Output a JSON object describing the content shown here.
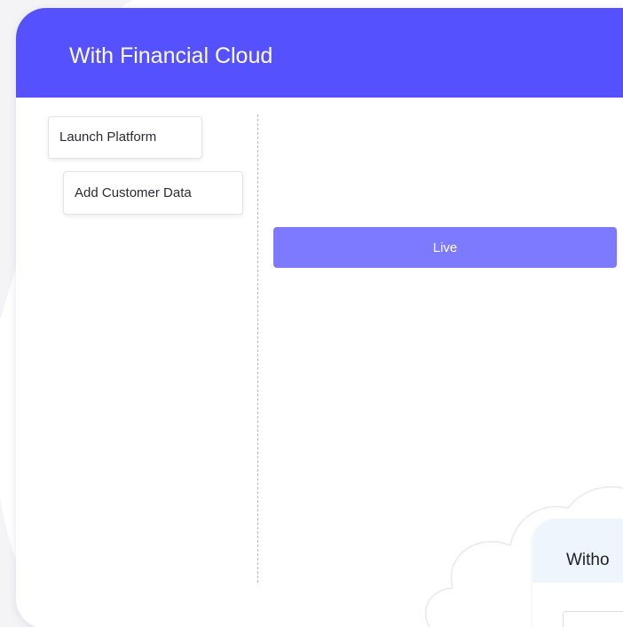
{
  "colors": {
    "header_bg": "#5551ff",
    "live_bar_bg": "#7d7aff",
    "without_header_bg": "#eef5fd",
    "divider": "#b9b9c2",
    "cloud": "#f3f3f6"
  },
  "main_card": {
    "title": "With Financial Cloud",
    "steps": [
      {
        "label": "Launch Platform"
      },
      {
        "label": "Add Customer Data"
      }
    ],
    "live_label": "Live"
  },
  "secondary_card": {
    "title": "Witho"
  }
}
